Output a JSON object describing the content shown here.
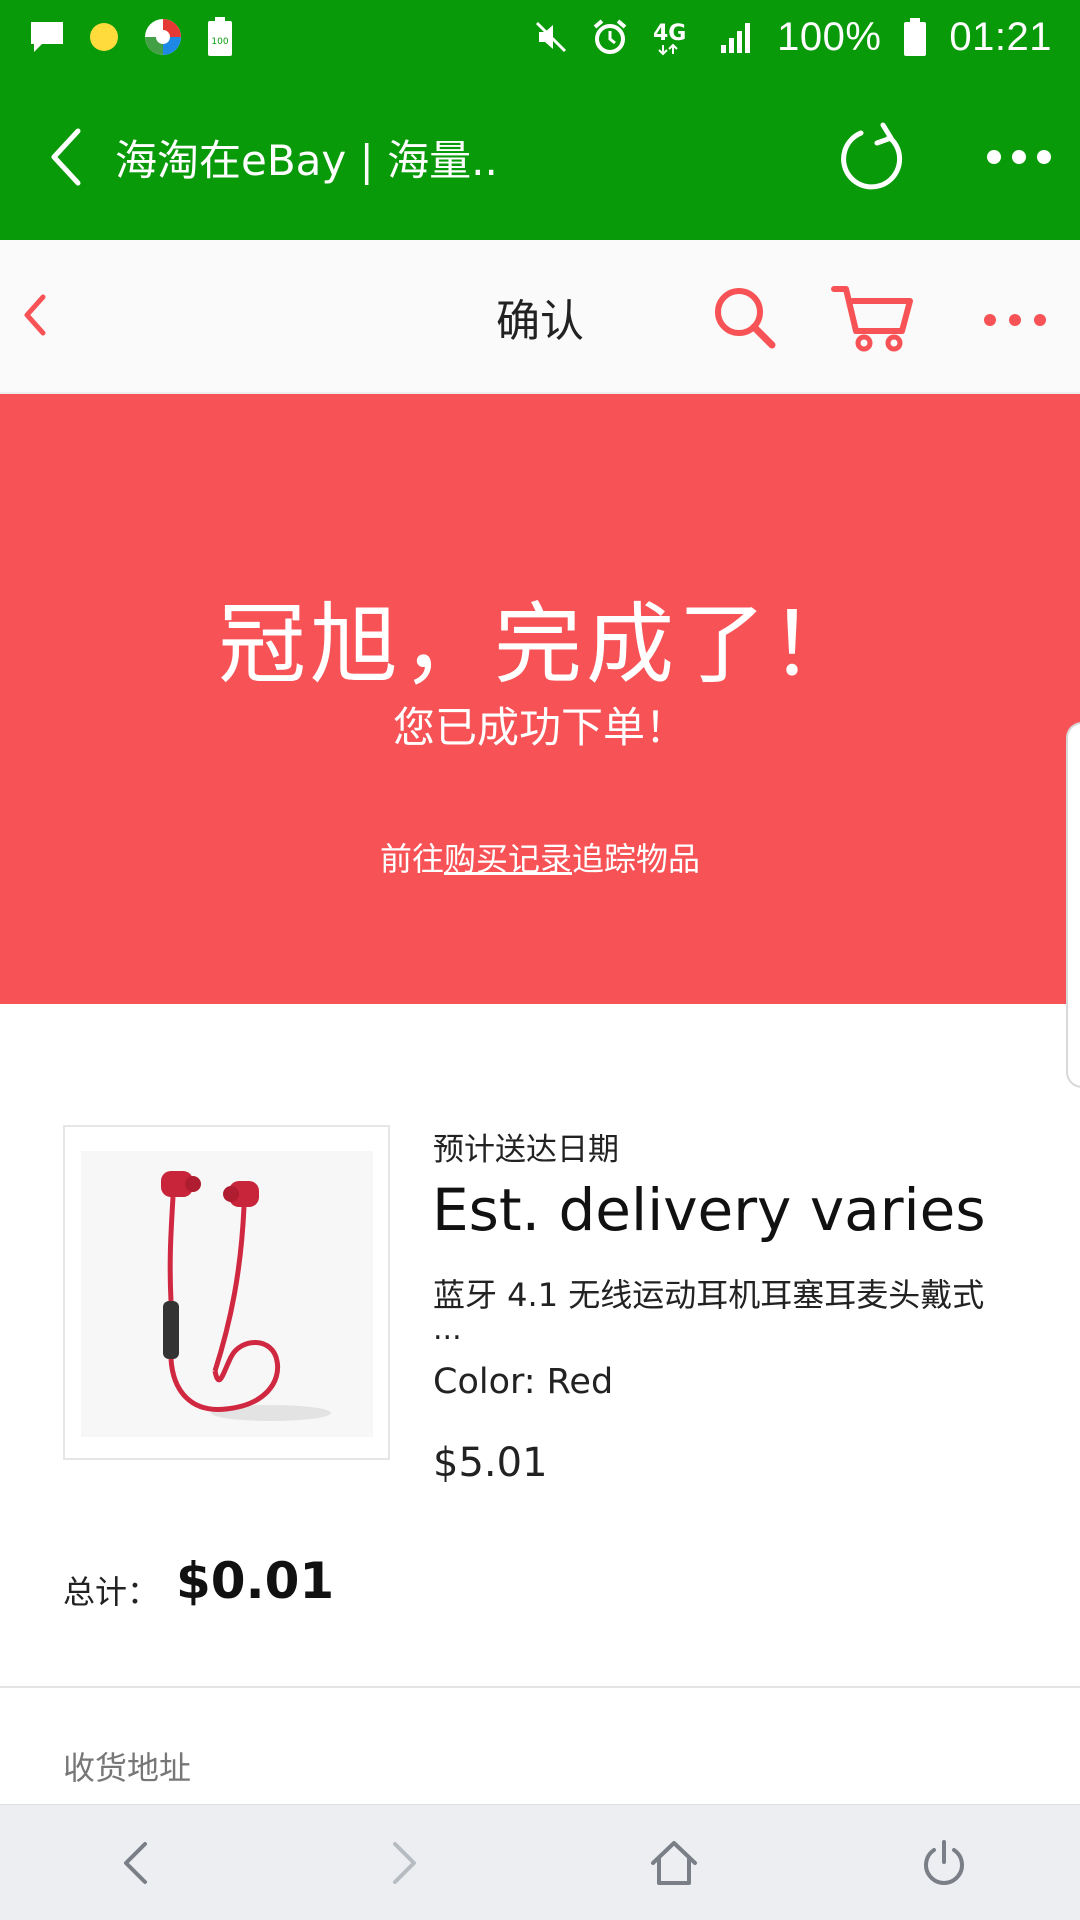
{
  "status_bar": {
    "battery_percent": "100%",
    "time": "01:21",
    "network": "4G",
    "battery_icon_label": "100"
  },
  "browser": {
    "title": "海淘在eBay | 海量.."
  },
  "header": {
    "title": "确认"
  },
  "banner": {
    "title": "冠旭，完成了！",
    "subtitle": "您已成功下单！",
    "link_prefix": "前往",
    "link_text": "购买记录",
    "link_suffix": "追踪物品",
    "background_color": "#f75356"
  },
  "item": {
    "delivery_label": "预计送达日期",
    "delivery_value": "Est. delivery varies",
    "title": "蓝牙 4.1 无线运动耳机耳塞耳麦头戴式",
    "title_ellipsis": "...",
    "color": "Color: Red",
    "price": "$5.01",
    "image_icon": "red-earphones-icon"
  },
  "total": {
    "label": "总计：",
    "value": "$0.01"
  },
  "address": {
    "label": "收货地址"
  },
  "colors": {
    "browser_green": "#099a0a",
    "accent_red": "#f75356"
  }
}
